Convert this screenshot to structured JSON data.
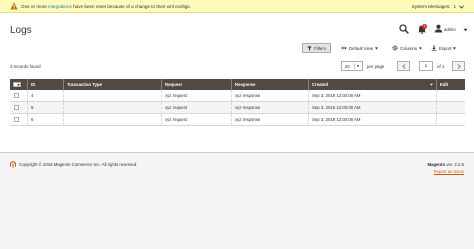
{
  "notice": {
    "message_prefix": "One or more",
    "message_link": "integrations",
    "message_suffix": "have been reset because of a change to their xml configs.",
    "system_messages_label": "System Messages:",
    "system_messages_count": "1"
  },
  "header": {
    "page_title": "Logs",
    "notification_count": "5",
    "user_name": "admin"
  },
  "toolbar": {
    "filters_label": "Filters",
    "default_view_label": "Default View",
    "columns_label": "Columns",
    "export_label": "Export"
  },
  "grid_info": {
    "records_found": "3 records found",
    "per_page_value": "20",
    "per_page_label": "per page",
    "current_page": "1",
    "of_label": "of 1"
  },
  "table": {
    "columns": [
      "ID",
      "Transaction Type",
      "Request",
      "Response",
      "Created",
      "Edit"
    ],
    "rows": [
      {
        "id": "4",
        "type": "",
        "request": "xyz request",
        "response": "xyz response",
        "created": "Sep 3, 2018 12:00:00 AM",
        "edit": ""
      },
      {
        "id": "5",
        "type": "",
        "request": "xyz request",
        "response": "xyz response",
        "created": "Sep 3, 2018 12:00:00 AM",
        "edit": ""
      },
      {
        "id": "6",
        "type": "",
        "request": "xyz request",
        "response": "xyz response",
        "created": "Sep 3, 2018 12:00:00 AM",
        "edit": ""
      }
    ]
  },
  "footer": {
    "copyright": "Copyright © 2018 Magento Commerce Inc. All rights reserved.",
    "product_name": "Magento",
    "version": "ver. 2.2.5",
    "report_issue": "Report an Issue"
  },
  "colors": {
    "notice_bg": "#fffbbb",
    "grid_header_bg": "#514943",
    "accent_orange": "#eb5202",
    "link_blue": "#1979c3",
    "badge_red": "#e22626"
  },
  "icons": [
    "warning-icon",
    "chevron-down-icon",
    "search-icon",
    "bell-icon",
    "user-icon",
    "filter-icon",
    "eye-icon",
    "gear-icon",
    "download-icon",
    "chevron-left-icon",
    "chevron-right-icon",
    "magento-logo-icon"
  ]
}
